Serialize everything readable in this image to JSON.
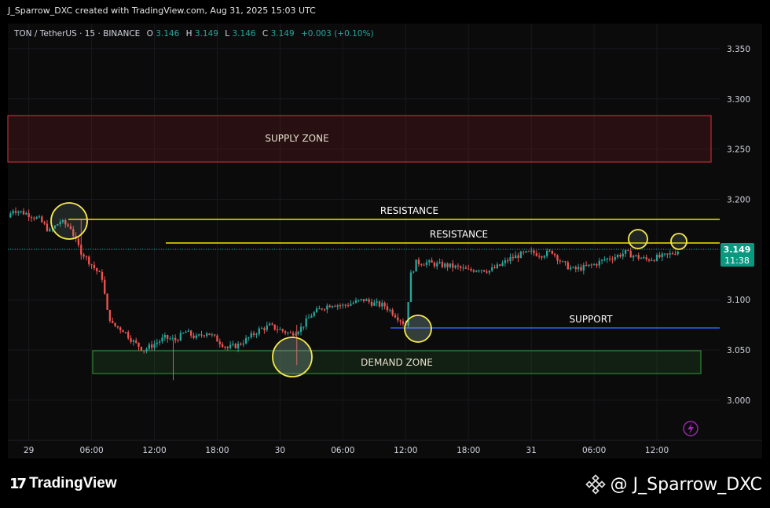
{
  "header": {
    "caption": "J_Sparrow_DXC created with TradingView.com, Aug 31, 2025 15:03 UTC"
  },
  "legend": {
    "symbol": "TON / TetherUS · 15 · BINANCE",
    "o_label": "O",
    "o_value": "3.146",
    "h_label": "H",
    "h_value": "3.149",
    "l_label": "L",
    "l_value": "3.146",
    "c_label": "C",
    "c_value": "3.149",
    "change": "+0.003 (+0.10%)"
  },
  "price_badge": {
    "price": "3.149",
    "countdown": "11:38"
  },
  "annotations": {
    "supply": "SUPPLY ZONE",
    "demand": "DEMAND ZONE",
    "resistance_1": "RESISTANCE",
    "resistance_2": "RESISTANCE",
    "support": "SUPPORT"
  },
  "footer": {
    "brand": "TradingView",
    "handle": "@ J_Sparrow_DXC"
  },
  "colors": {
    "up": "#26a69a",
    "down": "#ef5350",
    "resistance": "#f5e000",
    "support": "#2962ff",
    "supply": "#b22833",
    "demand": "#2e7d32",
    "highlight": "#f7e94a"
  },
  "chart_data": {
    "type": "candlestick",
    "symbol": "TON / TetherUS",
    "interval": "15",
    "exchange": "BINANCE",
    "y_ticks": [
      3.0,
      3.05,
      3.1,
      3.15,
      3.2,
      3.25,
      3.3,
      3.35
    ],
    "y_tick_labels": [
      "3.000",
      "3.050",
      "3.100",
      "3.150",
      "3.200",
      "3.250",
      "3.300",
      "3.350"
    ],
    "ylim": [
      2.96,
      3.375
    ],
    "x_ticks": [
      {
        "label": "29",
        "hours": 0
      },
      {
        "label": "06:00",
        "hours": 6
      },
      {
        "label": "12:00",
        "hours": 12
      },
      {
        "label": "18:00",
        "hours": 18
      },
      {
        "label": "30",
        "hours": 24
      },
      {
        "label": "06:00",
        "hours": 30
      },
      {
        "label": "12:00",
        "hours": 36
      },
      {
        "label": "18:00",
        "hours": 42
      },
      {
        "label": "31",
        "hours": 48
      },
      {
        "label": "06:00",
        "hours": 54
      },
      {
        "label": "12:00",
        "hours": 60
      }
    ],
    "xlim_hours": [
      -2.0,
      66.0
    ],
    "price_path": [
      [
        -2.0,
        3.182
      ],
      [
        -1.5,
        3.19
      ],
      [
        0.0,
        3.185
      ],
      [
        1.0,
        3.18
      ],
      [
        2.0,
        3.168
      ],
      [
        3.0,
        3.178
      ],
      [
        4.0,
        3.172
      ],
      [
        4.5,
        3.158
      ],
      [
        5.0,
        3.148
      ],
      [
        6.0,
        3.135
      ],
      [
        7.0,
        3.122
      ],
      [
        7.5,
        3.088
      ],
      [
        8.0,
        3.075
      ],
      [
        9.0,
        3.07
      ],
      [
        10.0,
        3.058
      ],
      [
        11.0,
        3.05
      ],
      [
        12.0,
        3.056
      ],
      [
        13.0,
        3.062
      ],
      [
        14.0,
        3.06
      ],
      [
        15.0,
        3.068
      ],
      [
        16.0,
        3.062
      ],
      [
        17.0,
        3.068
      ],
      [
        18.0,
        3.06
      ],
      [
        19.0,
        3.052
      ],
      [
        20.0,
        3.055
      ],
      [
        21.0,
        3.062
      ],
      [
        22.0,
        3.07
      ],
      [
        23.0,
        3.074
      ],
      [
        24.0,
        3.07
      ],
      [
        25.0,
        3.066
      ],
      [
        26.0,
        3.072
      ],
      [
        27.0,
        3.085
      ],
      [
        28.0,
        3.092
      ],
      [
        29.0,
        3.096
      ],
      [
        30.0,
        3.094
      ],
      [
        31.0,
        3.097
      ],
      [
        32.0,
        3.1
      ],
      [
        33.0,
        3.096
      ],
      [
        34.0,
        3.094
      ],
      [
        35.0,
        3.085
      ],
      [
        36.0,
        3.075
      ],
      [
        36.5,
        3.125
      ],
      [
        37.0,
        3.137
      ],
      [
        38.0,
        3.137
      ],
      [
        39.0,
        3.135
      ],
      [
        40.0,
        3.134
      ],
      [
        41.0,
        3.132
      ],
      [
        42.0,
        3.129
      ],
      [
        43.0,
        3.131
      ],
      [
        44.0,
        3.129
      ],
      [
        45.0,
        3.134
      ],
      [
        46.0,
        3.141
      ],
      [
        47.0,
        3.145
      ],
      [
        48.0,
        3.147
      ],
      [
        49.0,
        3.145
      ],
      [
        50.0,
        3.148
      ],
      [
        51.0,
        3.136
      ],
      [
        52.0,
        3.13
      ],
      [
        53.0,
        3.132
      ],
      [
        54.0,
        3.135
      ],
      [
        55.0,
        3.14
      ],
      [
        56.0,
        3.143
      ],
      [
        57.0,
        3.147
      ],
      [
        58.0,
        3.143
      ],
      [
        59.0,
        3.14
      ],
      [
        60.0,
        3.142
      ],
      [
        61.0,
        3.144
      ],
      [
        62.0,
        3.149
      ]
    ],
    "supply_zone": {
      "label": "SUPPLY ZONE",
      "price_low": 3.24,
      "price_high": 3.287,
      "from_hours": -2.0,
      "to_hours": 64.5
    },
    "demand_zone": {
      "label": "DEMAND ZONE",
      "price_low": 3.022,
      "price_high": 3.046,
      "from_hours": 6.0,
      "to_hours": 64.0
    },
    "resistance_lines": [
      {
        "label": "RESISTANCE",
        "price": 3.179,
        "from_hours": 4.0,
        "to_hours": 66.0
      },
      {
        "label": "RESISTANCE",
        "price": 3.155,
        "from_hours": 13.0,
        "to_hours": 66.0
      }
    ],
    "support_line": {
      "label": "SUPPORT",
      "price": 3.068,
      "from_hours": 34.5,
      "to_hours": 66.0
    },
    "highlight_circles": [
      {
        "hours": 2.6,
        "price": 3.178
      },
      {
        "hours": 25.5,
        "price": 3.046
      },
      {
        "hours": 37.0,
        "price": 3.068
      },
      {
        "hours": 56.5,
        "price": 3.16
      },
      {
        "hours": 59.5,
        "price": 3.158
      }
    ],
    "last_price": 3.149
  }
}
